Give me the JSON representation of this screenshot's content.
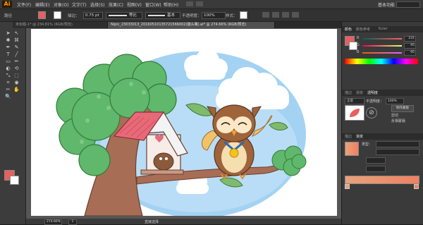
{
  "app": {
    "logo": "Ai",
    "workspace": "基本功能"
  },
  "menu": [
    "文件(F)",
    "编辑(E)",
    "对象(O)",
    "文字(T)",
    "选择(S)",
    "效果(C)",
    "视图(V)",
    "窗口(W)",
    "帮助(H)"
  ],
  "control": {
    "selection_label": "路径",
    "stroke_label": "描边：",
    "stroke_value": "0.75 pt",
    "profile_label": "等比",
    "brush_label": "基本",
    "opacity_label": "不透明度：",
    "opacity_value": "100%",
    "style_label": "样式："
  },
  "tabs": [
    {
      "label": "未标题-1* @ 234.81% (RGB/预览)",
      "active": false
    },
    {
      "label": "Nipic_23033013_20160510135721566002(猫头鹰).ai* @ 274.66% (RGB/预览)",
      "active": true
    }
  ],
  "color_panel": {
    "tabs": [
      "颜色",
      "颜色参考",
      "Kuler"
    ],
    "channels": [
      {
        "name": "R",
        "value": "231"
      },
      {
        "name": "G",
        "value": "95"
      },
      {
        "name": "B",
        "value": "95"
      }
    ],
    "fill_color": "#e75f5f"
  },
  "transparency_panel": {
    "tabs": [
      "描边",
      "渐变",
      "透明度"
    ],
    "mode": "正常",
    "opacity_label": "不透明度：",
    "opacity_value": "100%",
    "make_mask_label": "制作蒙版",
    "clip_label": "剪切",
    "invert_label": "反相蒙版"
  },
  "gradient_panel": {
    "tabs": [
      "描边",
      "渐变"
    ],
    "type_label": "类型："
  },
  "status": {
    "zoom": "274.66%",
    "page": "1",
    "tool_name": "直接选择"
  },
  "colors": {
    "accent_red": "#e75f5f",
    "gradient_start": "#e9a27a",
    "gradient_end": "#f08060",
    "sky": "#a3d2f3"
  }
}
